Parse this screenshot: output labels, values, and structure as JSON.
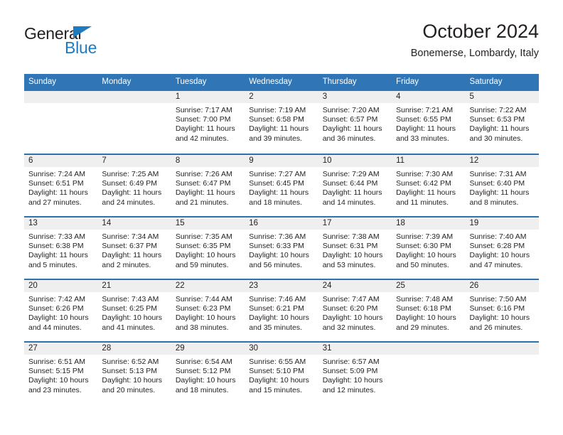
{
  "brand": {
    "name_dark": "General",
    "name_blue": "Blue",
    "accent_color": "#1f7ac0"
  },
  "header": {
    "title": "October 2024",
    "subtitle": "Bonemerse, Lombardy, Italy"
  },
  "colors": {
    "header_blue": "#3076b7",
    "row_divider_blue": "#2f72b2",
    "day_band_gray": "#efefef",
    "text": "#231f20"
  },
  "weekdays": [
    "Sunday",
    "Monday",
    "Tuesday",
    "Wednesday",
    "Thursday",
    "Friday",
    "Saturday"
  ],
  "weeks": [
    [
      {
        "day": "",
        "lines": []
      },
      {
        "day": "",
        "lines": []
      },
      {
        "day": "1",
        "lines": [
          "Sunrise: 7:17 AM",
          "Sunset: 7:00 PM",
          "Daylight: 11 hours",
          "and 42 minutes."
        ]
      },
      {
        "day": "2",
        "lines": [
          "Sunrise: 7:19 AM",
          "Sunset: 6:58 PM",
          "Daylight: 11 hours",
          "and 39 minutes."
        ]
      },
      {
        "day": "3",
        "lines": [
          "Sunrise: 7:20 AM",
          "Sunset: 6:57 PM",
          "Daylight: 11 hours",
          "and 36 minutes."
        ]
      },
      {
        "day": "4",
        "lines": [
          "Sunrise: 7:21 AM",
          "Sunset: 6:55 PM",
          "Daylight: 11 hours",
          "and 33 minutes."
        ]
      },
      {
        "day": "5",
        "lines": [
          "Sunrise: 7:22 AM",
          "Sunset: 6:53 PM",
          "Daylight: 11 hours",
          "and 30 minutes."
        ]
      }
    ],
    [
      {
        "day": "6",
        "lines": [
          "Sunrise: 7:24 AM",
          "Sunset: 6:51 PM",
          "Daylight: 11 hours",
          "and 27 minutes."
        ]
      },
      {
        "day": "7",
        "lines": [
          "Sunrise: 7:25 AM",
          "Sunset: 6:49 PM",
          "Daylight: 11 hours",
          "and 24 minutes."
        ]
      },
      {
        "day": "8",
        "lines": [
          "Sunrise: 7:26 AM",
          "Sunset: 6:47 PM",
          "Daylight: 11 hours",
          "and 21 minutes."
        ]
      },
      {
        "day": "9",
        "lines": [
          "Sunrise: 7:27 AM",
          "Sunset: 6:45 PM",
          "Daylight: 11 hours",
          "and 18 minutes."
        ]
      },
      {
        "day": "10",
        "lines": [
          "Sunrise: 7:29 AM",
          "Sunset: 6:44 PM",
          "Daylight: 11 hours",
          "and 14 minutes."
        ]
      },
      {
        "day": "11",
        "lines": [
          "Sunrise: 7:30 AM",
          "Sunset: 6:42 PM",
          "Daylight: 11 hours",
          "and 11 minutes."
        ]
      },
      {
        "day": "12",
        "lines": [
          "Sunrise: 7:31 AM",
          "Sunset: 6:40 PM",
          "Daylight: 11 hours",
          "and 8 minutes."
        ]
      }
    ],
    [
      {
        "day": "13",
        "lines": [
          "Sunrise: 7:33 AM",
          "Sunset: 6:38 PM",
          "Daylight: 11 hours",
          "and 5 minutes."
        ]
      },
      {
        "day": "14",
        "lines": [
          "Sunrise: 7:34 AM",
          "Sunset: 6:37 PM",
          "Daylight: 11 hours",
          "and 2 minutes."
        ]
      },
      {
        "day": "15",
        "lines": [
          "Sunrise: 7:35 AM",
          "Sunset: 6:35 PM",
          "Daylight: 10 hours",
          "and 59 minutes."
        ]
      },
      {
        "day": "16",
        "lines": [
          "Sunrise: 7:36 AM",
          "Sunset: 6:33 PM",
          "Daylight: 10 hours",
          "and 56 minutes."
        ]
      },
      {
        "day": "17",
        "lines": [
          "Sunrise: 7:38 AM",
          "Sunset: 6:31 PM",
          "Daylight: 10 hours",
          "and 53 minutes."
        ]
      },
      {
        "day": "18",
        "lines": [
          "Sunrise: 7:39 AM",
          "Sunset: 6:30 PM",
          "Daylight: 10 hours",
          "and 50 minutes."
        ]
      },
      {
        "day": "19",
        "lines": [
          "Sunrise: 7:40 AM",
          "Sunset: 6:28 PM",
          "Daylight: 10 hours",
          "and 47 minutes."
        ]
      }
    ],
    [
      {
        "day": "20",
        "lines": [
          "Sunrise: 7:42 AM",
          "Sunset: 6:26 PM",
          "Daylight: 10 hours",
          "and 44 minutes."
        ]
      },
      {
        "day": "21",
        "lines": [
          "Sunrise: 7:43 AM",
          "Sunset: 6:25 PM",
          "Daylight: 10 hours",
          "and 41 minutes."
        ]
      },
      {
        "day": "22",
        "lines": [
          "Sunrise: 7:44 AM",
          "Sunset: 6:23 PM",
          "Daylight: 10 hours",
          "and 38 minutes."
        ]
      },
      {
        "day": "23",
        "lines": [
          "Sunrise: 7:46 AM",
          "Sunset: 6:21 PM",
          "Daylight: 10 hours",
          "and 35 minutes."
        ]
      },
      {
        "day": "24",
        "lines": [
          "Sunrise: 7:47 AM",
          "Sunset: 6:20 PM",
          "Daylight: 10 hours",
          "and 32 minutes."
        ]
      },
      {
        "day": "25",
        "lines": [
          "Sunrise: 7:48 AM",
          "Sunset: 6:18 PM",
          "Daylight: 10 hours",
          "and 29 minutes."
        ]
      },
      {
        "day": "26",
        "lines": [
          "Sunrise: 7:50 AM",
          "Sunset: 6:16 PM",
          "Daylight: 10 hours",
          "and 26 minutes."
        ]
      }
    ],
    [
      {
        "day": "27",
        "lines": [
          "Sunrise: 6:51 AM",
          "Sunset: 5:15 PM",
          "Daylight: 10 hours",
          "and 23 minutes."
        ]
      },
      {
        "day": "28",
        "lines": [
          "Sunrise: 6:52 AM",
          "Sunset: 5:13 PM",
          "Daylight: 10 hours",
          "and 20 minutes."
        ]
      },
      {
        "day": "29",
        "lines": [
          "Sunrise: 6:54 AM",
          "Sunset: 5:12 PM",
          "Daylight: 10 hours",
          "and 18 minutes."
        ]
      },
      {
        "day": "30",
        "lines": [
          "Sunrise: 6:55 AM",
          "Sunset: 5:10 PM",
          "Daylight: 10 hours",
          "and 15 minutes."
        ]
      },
      {
        "day": "31",
        "lines": [
          "Sunrise: 6:57 AM",
          "Sunset: 5:09 PM",
          "Daylight: 10 hours",
          "and 12 minutes."
        ]
      },
      {
        "day": "",
        "lines": []
      },
      {
        "day": "",
        "lines": []
      }
    ]
  ]
}
